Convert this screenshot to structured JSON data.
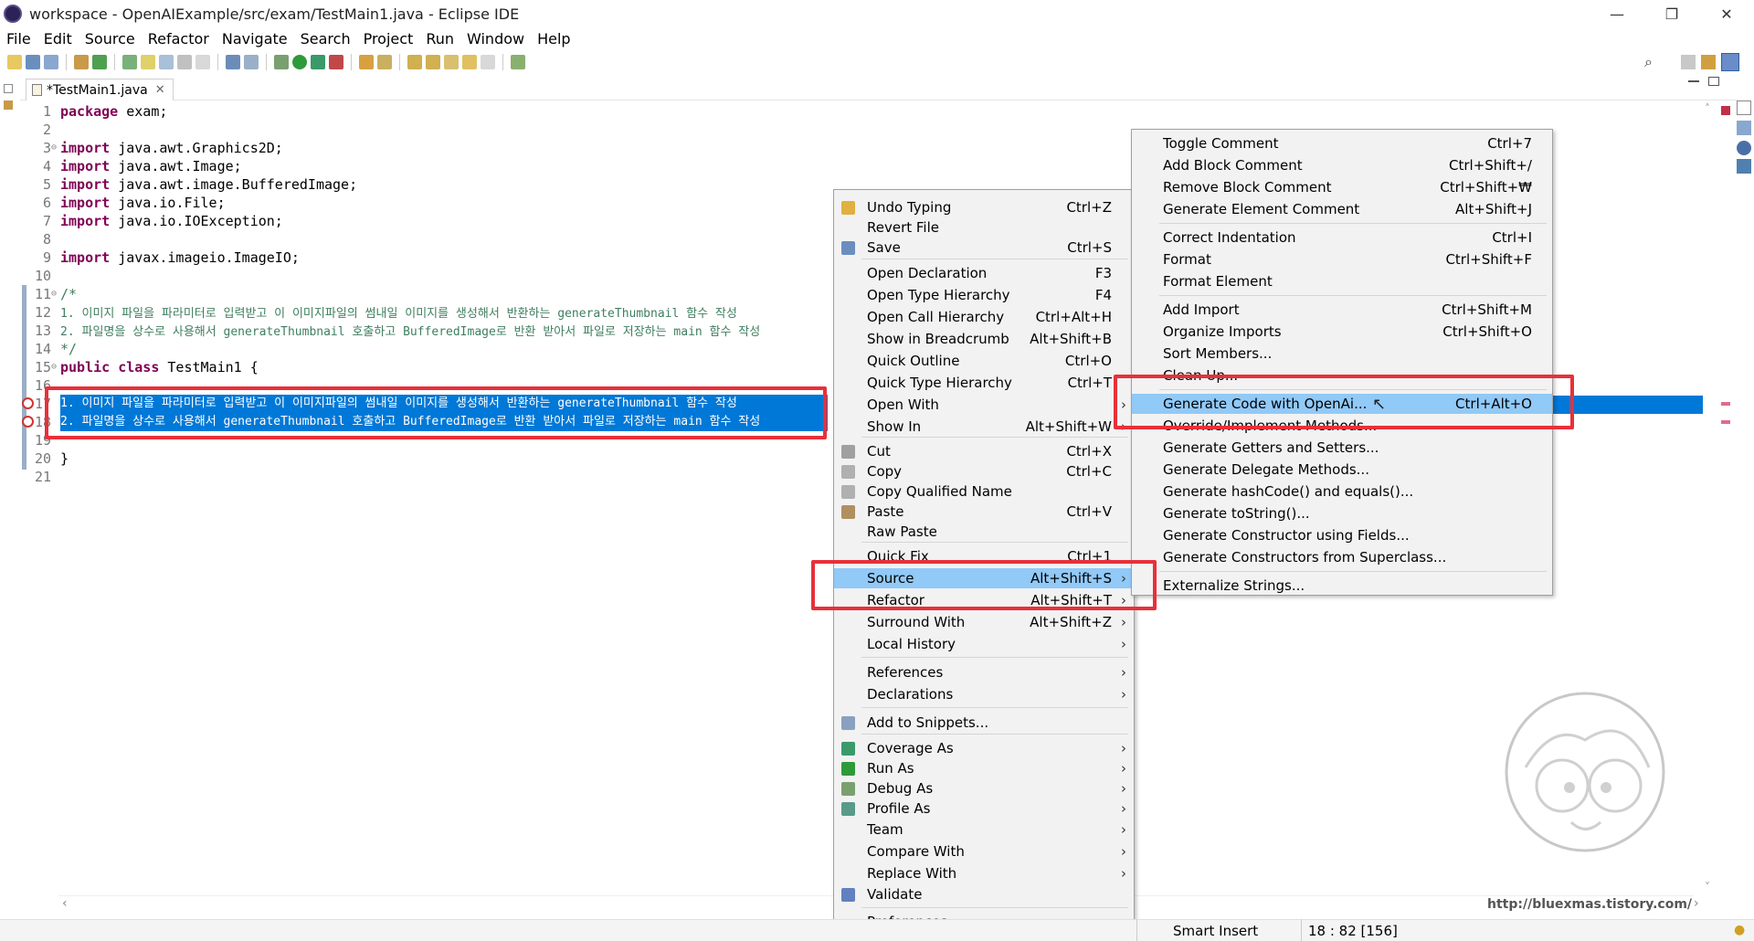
{
  "window": {
    "title": "workspace - OpenAIExample/src/exam/TestMain1.java - Eclipse IDE",
    "minimize": "—",
    "restore": "❐",
    "close": "✕"
  },
  "menubar": [
    "File",
    "Edit",
    "Source",
    "Refactor",
    "Navigate",
    "Search",
    "Project",
    "Run",
    "Window",
    "Help"
  ],
  "editor_tab": {
    "label": "*TestMain1.java",
    "close": "✕"
  },
  "code": {
    "lines": [
      {
        "n": "1",
        "kw": "package",
        "rest": " exam;"
      },
      {
        "n": "2",
        "kw": "",
        "rest": ""
      },
      {
        "n": "3",
        "kw": "import",
        "rest": " java.awt.Graphics2D;"
      },
      {
        "n": "4",
        "kw": "import",
        "rest": " java.awt.Image;"
      },
      {
        "n": "5",
        "kw": "import",
        "rest": " java.awt.image.BufferedImage;"
      },
      {
        "n": "6",
        "kw": "import",
        "rest": " java.io.File;"
      },
      {
        "n": "7",
        "kw": "import",
        "rest": " java.io.IOException;"
      },
      {
        "n": "8",
        "kw": "",
        "rest": ""
      },
      {
        "n": "9",
        "kw": "import",
        "rest": " javax.imageio.ImageIO;"
      },
      {
        "n": "10",
        "kw": "",
        "rest": ""
      },
      {
        "n": "11",
        "kw": "",
        "rest": "/*"
      },
      {
        "n": "12",
        "kw": "",
        "rest": "1. 이미지 파일을 파라미터로 입력받고 이 이미지파일의 썸내일 이미지를 생성해서 반환하는 generateThumbnail 함수 작성"
      },
      {
        "n": "13",
        "kw": "",
        "rest": "2. 파일명을 상수로 사용해서 generateThumbnail 호출하고 BufferedImage로 반환 받아서 파일로 저장하는 main 함수 작성"
      },
      {
        "n": "14",
        "kw": "",
        "rest": "*/"
      },
      {
        "n": "15",
        "kw": "public class",
        "rest": " TestMain1 {"
      },
      {
        "n": "16",
        "kw": "",
        "rest": ""
      },
      {
        "n": "17",
        "kw": "",
        "rest": "1. 이미지 파일을 파라미터로 입력받고 이 이미지파일의 썸내일 이미지를 생성해서 반환하는 generateThumbnail 함수 작성"
      },
      {
        "n": "18",
        "kw": "",
        "rest": "2. 파일명을 상수로 사용해서 generateThumbnail 호출하고 BufferedImage로 반환 받아서 파일로 저장하는 main 함수 작성"
      },
      {
        "n": "19",
        "kw": "",
        "rest": ""
      },
      {
        "n": "20",
        "kw": "",
        "rest": "}"
      },
      {
        "n": "21",
        "kw": "",
        "rest": ""
      }
    ]
  },
  "context_menu": {
    "items": [
      {
        "label": "Undo Typing",
        "shortcut": "Ctrl+Z",
        "icon": "undo-icon"
      },
      {
        "label": "Revert File",
        "shortcut": ""
      },
      {
        "label": "Save",
        "shortcut": "Ctrl+S",
        "icon": "save-icon"
      },
      {
        "label": "Open Declaration",
        "shortcut": "F3"
      },
      {
        "label": "Open Type Hierarchy",
        "shortcut": "F4"
      },
      {
        "label": "Open Call Hierarchy",
        "shortcut": "Ctrl+Alt+H"
      },
      {
        "label": "Show in Breadcrumb",
        "shortcut": "Alt+Shift+B"
      },
      {
        "label": "Quick Outline",
        "shortcut": "Ctrl+O"
      },
      {
        "label": "Quick Type Hierarchy",
        "shortcut": "Ctrl+T"
      },
      {
        "label": "Open With",
        "shortcut": ""
      },
      {
        "label": "Show In",
        "shortcut": "Alt+Shift+W"
      },
      {
        "label": "Cut",
        "shortcut": "Ctrl+X",
        "icon": "cut-icon"
      },
      {
        "label": "Copy",
        "shortcut": "Ctrl+C",
        "icon": "copy-icon"
      },
      {
        "label": "Copy Qualified Name",
        "shortcut": "",
        "icon": "copy-qualified-icon"
      },
      {
        "label": "Paste",
        "shortcut": "Ctrl+V",
        "icon": "paste-icon"
      },
      {
        "label": "Raw Paste",
        "shortcut": ""
      },
      {
        "label": "Quick Fix",
        "shortcut": "Ctrl+1"
      },
      {
        "label": "Source",
        "shortcut": "Alt+Shift+S"
      },
      {
        "label": "Refactor",
        "shortcut": "Alt+Shift+T"
      },
      {
        "label": "Surround With",
        "shortcut": "Alt+Shift+Z"
      },
      {
        "label": "Local History",
        "shortcut": ""
      },
      {
        "label": "References",
        "shortcut": ""
      },
      {
        "label": "Declarations",
        "shortcut": ""
      },
      {
        "label": "Add to Snippets...",
        "shortcut": "",
        "icon": "snippet-icon"
      },
      {
        "label": "Coverage As",
        "shortcut": "",
        "icon": "coverage-icon"
      },
      {
        "label": "Run As",
        "shortcut": "",
        "icon": "run-icon"
      },
      {
        "label": "Debug As",
        "shortcut": "",
        "icon": "debug-icon"
      },
      {
        "label": "Profile As",
        "shortcut": "",
        "icon": "profile-icon"
      },
      {
        "label": "Team",
        "shortcut": ""
      },
      {
        "label": "Compare With",
        "shortcut": ""
      },
      {
        "label": "Replace With",
        "shortcut": ""
      },
      {
        "label": "Validate",
        "shortcut": "",
        "icon": "validate-icon"
      },
      {
        "label": "Preferences...",
        "shortcut": ""
      }
    ],
    "submenu_arrow": "›"
  },
  "source_menu": {
    "items": [
      {
        "label": "Toggle Comment",
        "shortcut": "Ctrl+7"
      },
      {
        "label": "Add Block Comment",
        "shortcut": "Ctrl+Shift+/"
      },
      {
        "label": "Remove Block Comment",
        "shortcut": "Ctrl+Shift+₩"
      },
      {
        "label": "Generate Element Comment",
        "shortcut": "Alt+Shift+J"
      },
      {
        "label": "Correct Indentation",
        "shortcut": "Ctrl+I"
      },
      {
        "label": "Format",
        "shortcut": "Ctrl+Shift+F"
      },
      {
        "label": "Format Element",
        "shortcut": ""
      },
      {
        "label": "Add Import",
        "shortcut": "Ctrl+Shift+M"
      },
      {
        "label": "Organize Imports",
        "shortcut": "Ctrl+Shift+O"
      },
      {
        "label": "Sort Members...",
        "shortcut": ""
      },
      {
        "label": "Clean Up...",
        "shortcut": ""
      },
      {
        "label": "Generate Code with OpenAi...",
        "shortcut": "Ctrl+Alt+O"
      },
      {
        "label": "Override/Implement Methods...",
        "shortcut": ""
      },
      {
        "label": "Generate Getters and Setters...",
        "shortcut": ""
      },
      {
        "label": "Generate Delegate Methods...",
        "shortcut": ""
      },
      {
        "label": "Generate hashCode() and equals()...",
        "shortcut": ""
      },
      {
        "label": "Generate toString()...",
        "shortcut": ""
      },
      {
        "label": "Generate Constructor using Fields...",
        "shortcut": ""
      },
      {
        "label": "Generate Constructors from Superclass...",
        "shortcut": ""
      },
      {
        "label": "Externalize Strings...",
        "shortcut": ""
      }
    ]
  },
  "status": {
    "insert_mode": "Smart Insert",
    "position": "18 : 82 [156]"
  },
  "watermark": {
    "url": "http://bluexmas.tistory.com/"
  },
  "colors": {
    "selection": "#0078d7",
    "menu_highlight": "#91c9f7",
    "annotation_box": "#e8303a",
    "keyword": "#7f0055",
    "comment": "#3f7f5f"
  }
}
